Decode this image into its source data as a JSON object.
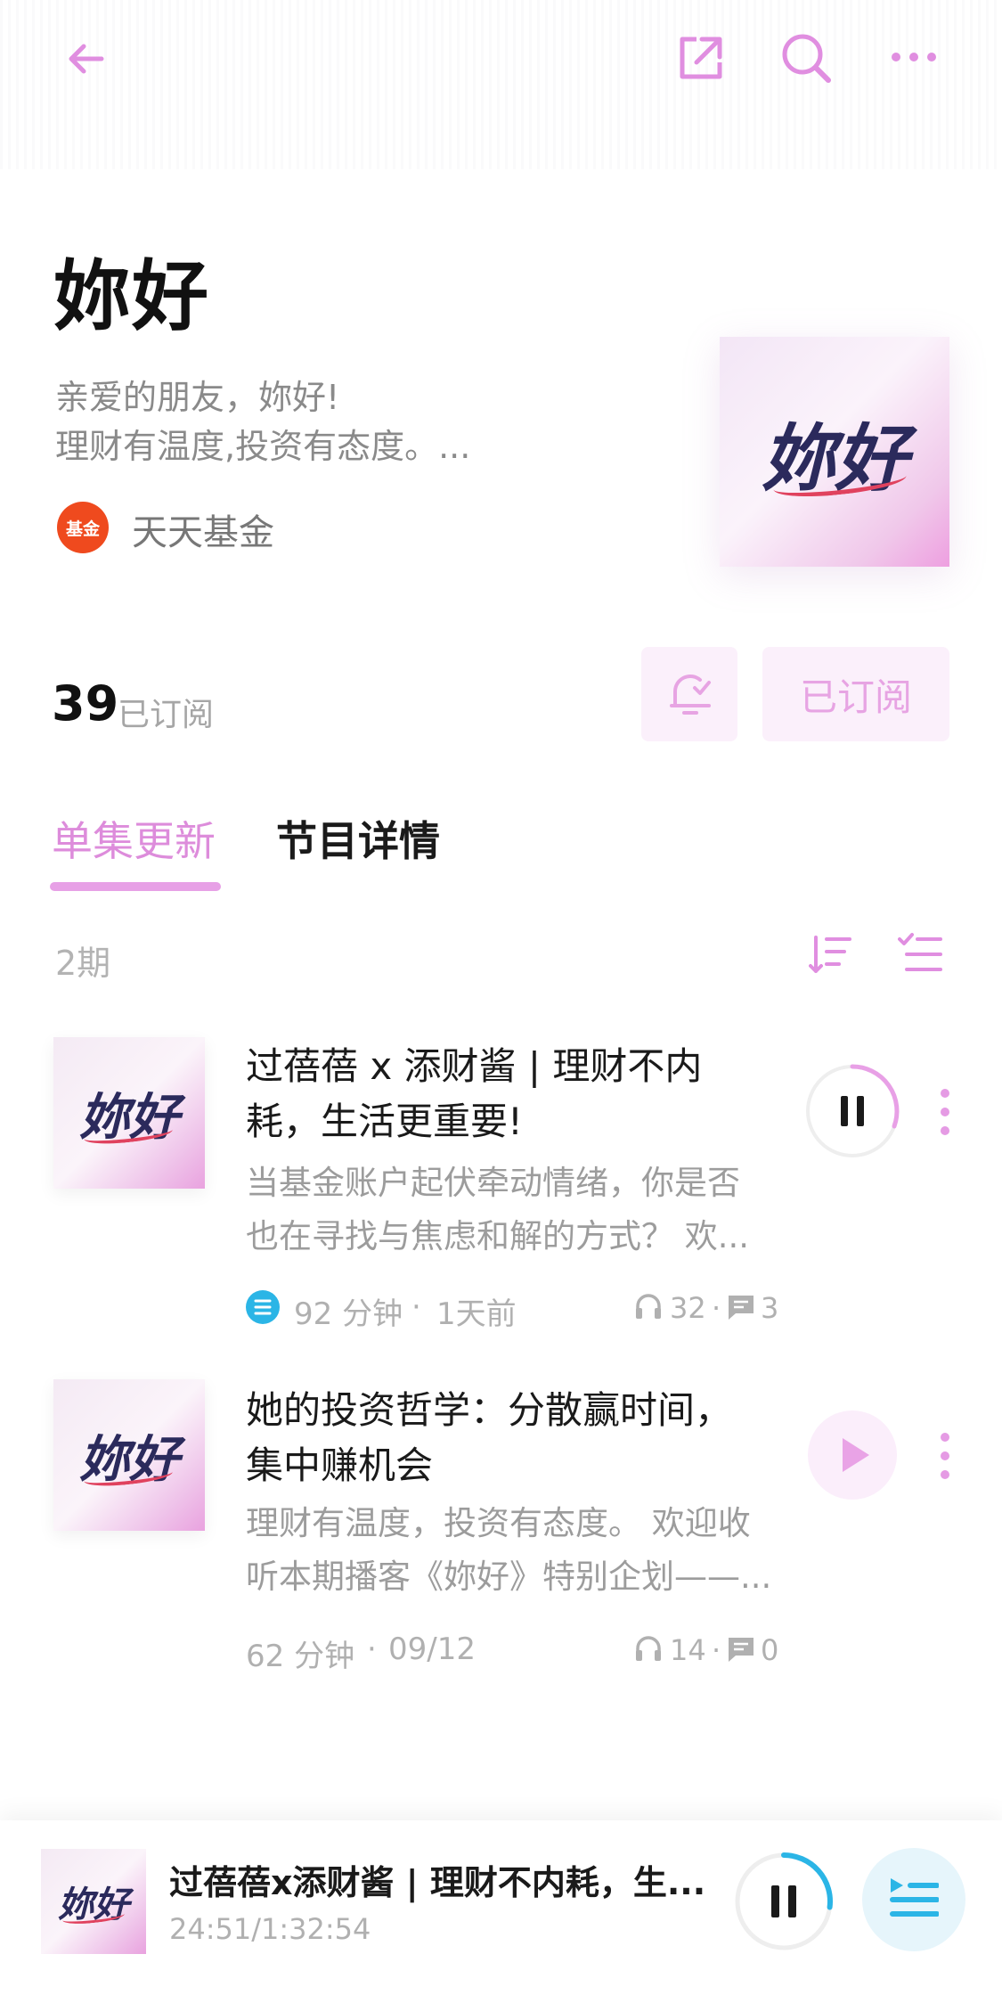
{
  "header": {
    "back_icon": "arrow-left-icon",
    "share_icon": "share-icon",
    "search_icon": "search-icon",
    "more_icon": "more-horizontal-icon",
    "accent": "#e08ee0"
  },
  "podcast": {
    "title": "妳好",
    "description_line1": "亲爱的朋友，妳好!",
    "description_line2": "理财有温度,投资有态度。...",
    "author_logo_text": "基金",
    "author_name": "天天基金",
    "cover_text": "妳好",
    "subscriber_count": "39",
    "subscriber_label": "已订阅",
    "subscribe_button_label": "已订阅"
  },
  "tabs": [
    {
      "label": "单集更新",
      "active": true
    },
    {
      "label": "节目详情",
      "active": false
    }
  ],
  "episodes_header": {
    "count_label": "2期",
    "sort_icon": "sort-icon",
    "multi_select_icon": "checklist-icon"
  },
  "episodes": [
    {
      "title": "过蓓蓓 x 添财酱 | 理财不内耗，生活更重要!",
      "title_line1": "过蓓蓓 x 添财酱 | 理财不内",
      "title_line2": "耗，生活更重要!",
      "desc_line1": "当基金账户起伏牵动情绪，你是否",
      "desc_line2": "也在寻找与焦虑和解的方式？ 欢...",
      "duration": "92 分钟",
      "sep": "·",
      "date": "1天前",
      "plays": "32",
      "comments": "3",
      "state": "playing",
      "cover_text": "妳好"
    },
    {
      "title": "她的投资哲学：分散赢时间，集中赚机会",
      "title_line1": "她的投资哲学：分散赢时间，",
      "title_line2": "集中赚机会",
      "desc_line1": "理财有温度，投资有态度。 欢迎收",
      "desc_line2": "听本期播客《妳好》特别企划——...",
      "duration": "62 分钟",
      "sep": "·",
      "date": "09/12",
      "plays": "14",
      "comments": "0",
      "state": "paused",
      "cover_text": "妳好"
    }
  ],
  "mini_player": {
    "title": "过蓓蓓x添财酱 | 理财不内耗，生...",
    "time": "24:51/1:32:54",
    "cover_text": "妳好",
    "progress": 0.27,
    "playlist_icon": "playlist-icon"
  }
}
